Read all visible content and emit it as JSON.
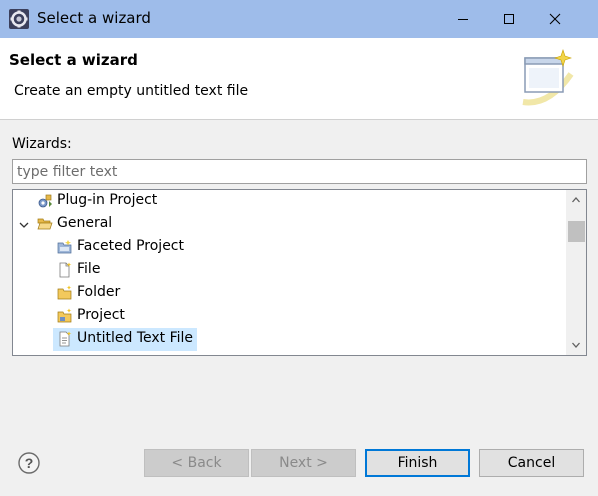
{
  "window": {
    "title": "Select a wizard",
    "controls": [
      "minimize-icon",
      "maximize-icon",
      "close-icon"
    ]
  },
  "header": {
    "title": "Select a wizard",
    "description": "Create an empty untitled text file"
  },
  "wizards": {
    "label": "Wizards:",
    "filter_placeholder": "type filter text",
    "filter_value": ""
  },
  "tree": {
    "items": [
      {
        "label": "Plug-in Project",
        "icon": "plugin-project-icon",
        "depth": 1,
        "twisty": "none",
        "selected": false
      },
      {
        "label": "General",
        "icon": "folder-open-icon",
        "depth": 0,
        "twisty": "expanded",
        "selected": false
      },
      {
        "label": "Faceted Project",
        "icon": "faceted-project-icon",
        "depth": 2,
        "twisty": "none",
        "selected": false
      },
      {
        "label": "File",
        "icon": "file-new-icon",
        "depth": 2,
        "twisty": "none",
        "selected": false
      },
      {
        "label": "Folder",
        "icon": "folder-new-icon",
        "depth": 2,
        "twisty": "none",
        "selected": false
      },
      {
        "label": "Project",
        "icon": "project-new-icon",
        "depth": 2,
        "twisty": "none",
        "selected": false
      },
      {
        "label": "Untitled Text File",
        "icon": "text-file-icon",
        "depth": 2,
        "twisty": "none",
        "selected": true
      }
    ]
  },
  "buttons": {
    "back": "< Back",
    "next": "Next >",
    "finish": "Finish",
    "cancel": "Cancel"
  },
  "colors": {
    "titlebar": "#9ebcea",
    "selection": "#cce8ff",
    "default_button_border": "#0078d7"
  }
}
